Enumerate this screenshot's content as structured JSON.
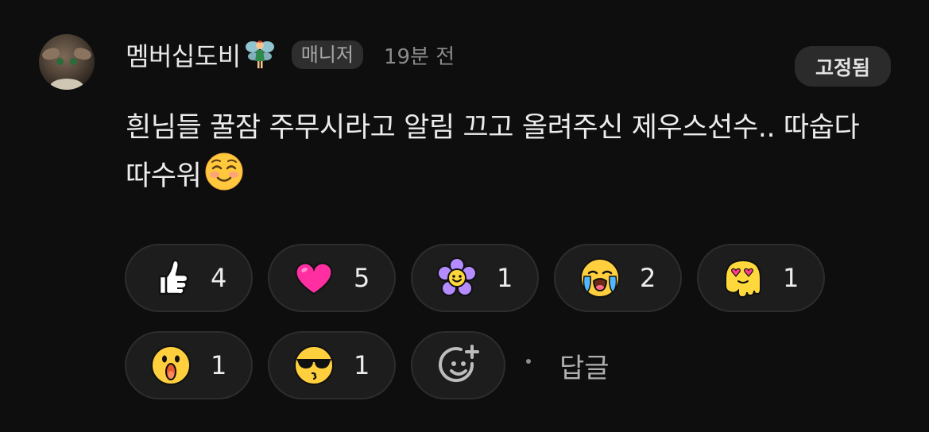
{
  "comment": {
    "author": "멤버십도비",
    "author_badge_emoji": "fairy",
    "role": "매니저",
    "time": "19분 전",
    "pinned_label": "고정됨",
    "text": "흰님들 꿀잠 주무시라고 알림 끄고 올려주신 제우스선수.. 따숩다 따수워",
    "text_emoji": "smiling-face-emoji"
  },
  "reactions": [
    {
      "icon": "thumbs-up-icon",
      "count": "4"
    },
    {
      "icon": "heart-icon",
      "count": "5"
    },
    {
      "icon": "flower-icon",
      "count": "1"
    },
    {
      "icon": "crying-face-icon",
      "count": "2"
    },
    {
      "icon": "melting-heart-eyes-icon",
      "count": "1"
    },
    {
      "icon": "surprised-face-icon",
      "count": "1"
    },
    {
      "icon": "sunglasses-kiss-icon",
      "count": "1"
    }
  ],
  "add_reaction_icon": "add-emoji-icon",
  "reply_label": "답글"
}
